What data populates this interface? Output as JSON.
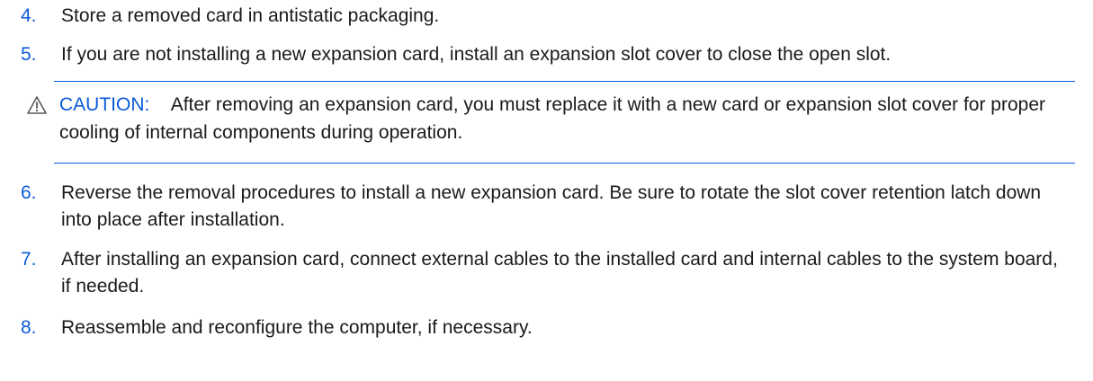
{
  "colors": {
    "accent": "#0b5ad9",
    "text": "#1a1a1a"
  },
  "steps": [
    {
      "number": "4.",
      "text": "Store a removed card in antistatic packaging."
    },
    {
      "number": "5.",
      "text": "If you are not installing a new expansion card, install an expansion slot cover to close the open slot."
    },
    {
      "number": "6.",
      "text": "Reverse the removal procedures to install a new expansion card. Be sure to rotate the slot cover retention latch down into place after installation."
    },
    {
      "number": "7.",
      "text": "After installing an expansion card, connect external cables to the installed card and internal cables to the system board, if needed."
    },
    {
      "number": "8.",
      "text": "Reassemble and reconfigure the computer, if necessary."
    }
  ],
  "caution": {
    "icon": "warning-triangle-icon",
    "label": "CAUTION:",
    "text": "After removing an expansion card, you must replace it with a new card or expansion slot cover for proper cooling of internal components during operation."
  }
}
